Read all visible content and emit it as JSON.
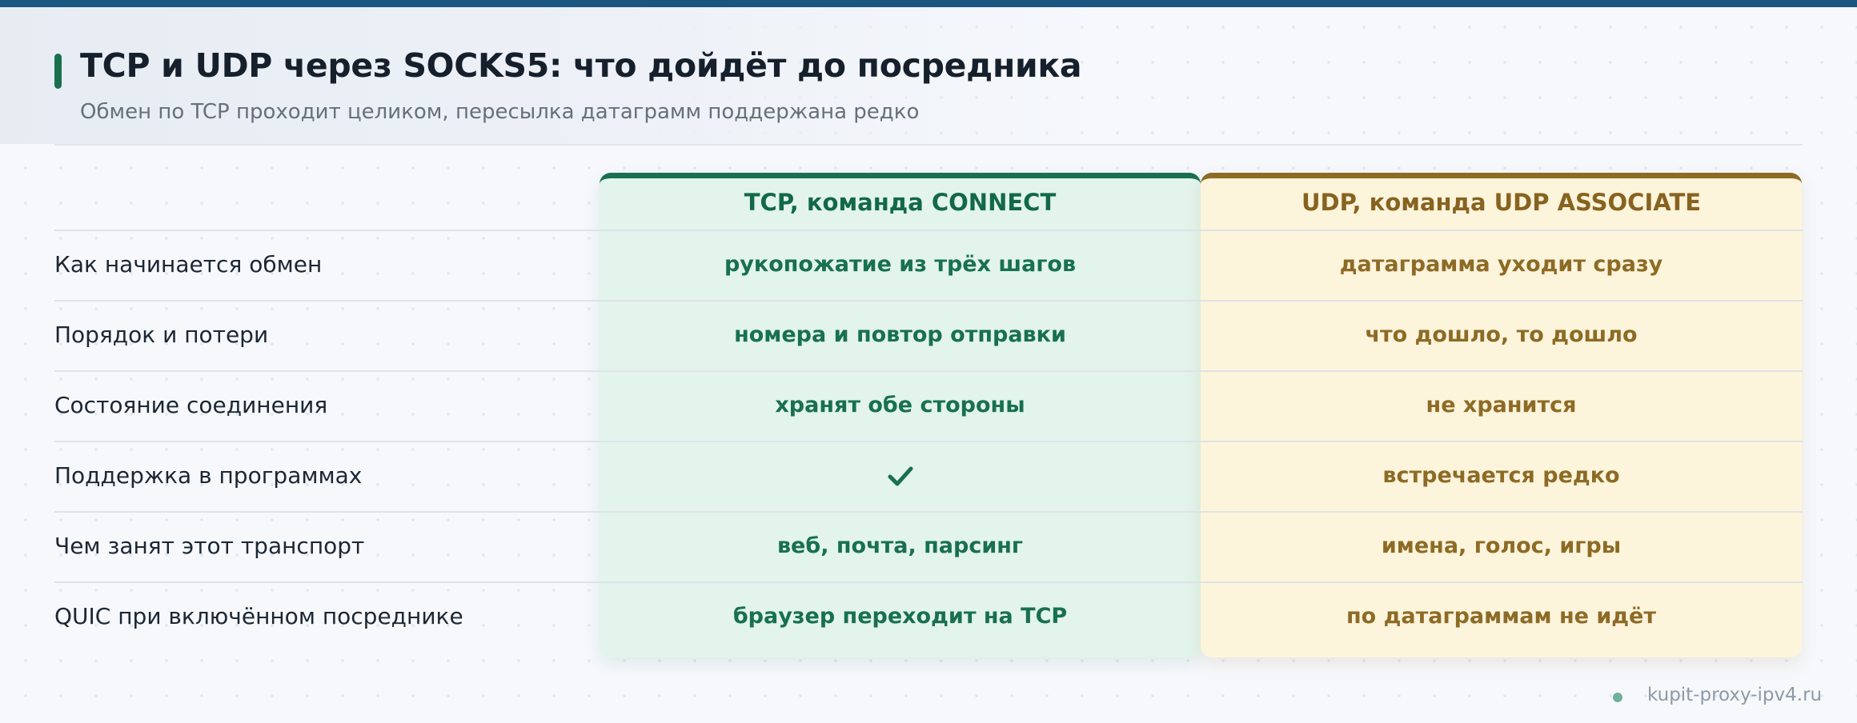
{
  "header": {
    "title": "TCP и UDP через SOCKS5: что дойдёт до посредника",
    "subtitle": "Обмен по TCP проходит целиком, пересылка датаграмм поддержана редко"
  },
  "columns": {
    "tcp": {
      "label": "TCP, команда CONNECT",
      "color": "#18704f"
    },
    "udp": {
      "label": "UDP, команда UDP ASSOCIATE",
      "color": "#8d6b25"
    }
  },
  "rows": [
    {
      "label": "Как начинается обмен",
      "tcp": "рукопожатие из трёх шагов",
      "udp": "датаграмма уходит сразу"
    },
    {
      "label": "Порядок и потери",
      "tcp": "номера и повтор отправки",
      "udp": "что дошло, то дошло"
    },
    {
      "label": "Состояние соединения",
      "tcp": "хранят обе стороны",
      "udp": "не хранится"
    },
    {
      "label": "Поддержка в программах",
      "tcp_icon": "checkmark-icon",
      "udp": "встречается редко"
    },
    {
      "label": "Чем занят этот транспорт",
      "tcp": "веб, почта, парсинг",
      "udp": "имена, голос, игры"
    },
    {
      "label": "QUIC при включённом посреднике",
      "tcp": "браузер переходит на TCP",
      "udp": "по датаграммам не идёт"
    }
  ],
  "footer": {
    "site": "kupit-proxy-ipv4.ru"
  }
}
